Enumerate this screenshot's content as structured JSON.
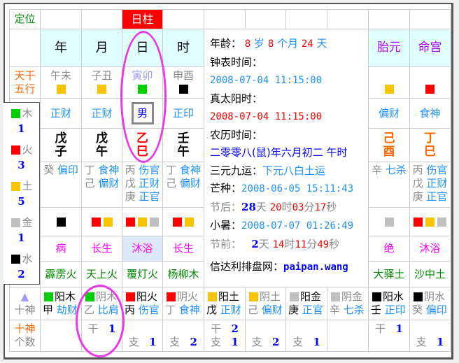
{
  "header": {
    "dingwei": "定位",
    "rizhu": "日柱",
    "pillars": [
      "年",
      "月",
      "日",
      "时"
    ],
    "taiyuan": "胎元",
    "minggong": "命宫"
  },
  "labels": {
    "tiangan_wuxing": [
      "天干",
      "五行"
    ],
    "shishen": "十神",
    "shishen_count": [
      "十神",
      "个数"
    ],
    "triangle": "▲"
  },
  "kongwang": [
    "午未",
    "子丑",
    "寅卯",
    "申酉"
  ],
  "kongwang_colors": [
    "#f8c400",
    "#f8c400",
    "#00d000",
    "#000000"
  ],
  "stem_gods": [
    "正财",
    "正财",
    "男",
    "正印"
  ],
  "pillar_chars": [
    [
      "戊",
      "子"
    ],
    [
      "戊",
      "午"
    ],
    [
      "乙",
      "巳"
    ],
    [
      "壬",
      "午"
    ]
  ],
  "hidden": [
    [
      [
        "癸",
        "偏印"
      ]
    ],
    [
      [
        "丁",
        "食神"
      ],
      [
        "己",
        "偏财"
      ]
    ],
    [
      [
        "丙",
        "伤官"
      ],
      [
        "戊",
        "正财"
      ],
      [
        "庚",
        "正官"
      ]
    ],
    [
      [
        "丁",
        "食神"
      ],
      [
        "己",
        "偏财"
      ]
    ]
  ],
  "hidden_colors": [
    [
      "#000000"
    ],
    [
      "#ff0000",
      "#f8c400"
    ],
    [
      "#ff0000",
      "#f8c400",
      "#c0c0c0"
    ],
    [
      "#ff0000",
      "#f8c400"
    ]
  ],
  "changsheng": [
    "病",
    "长生",
    "沐浴",
    "长生"
  ],
  "nayin": [
    "霹雳火",
    "天上火",
    "覆灯火",
    "杨柳木"
  ],
  "extra": {
    "colors": [
      "#f8c400",
      "#ff0000"
    ],
    "gods": [
      "偏财",
      "食神"
    ],
    "chars": [
      [
        "己",
        "酉"
      ],
      [
        "丁",
        "巳"
      ]
    ],
    "hidden": [
      [
        [
          "辛",
          "七杀"
        ]
      ],
      [
        [
          "丙",
          "伤官"
        ],
        [
          "戊",
          "正财"
        ],
        [
          "庚",
          "正官"
        ]
      ]
    ],
    "hidden_colors": [
      [
        "#c0c0c0"
      ],
      [
        "#ff0000",
        "#f8c400",
        "#c0c0c0"
      ]
    ],
    "changsheng": [
      "绝",
      "沐浴"
    ],
    "nayin": [
      "大驿土",
      "沙中土"
    ]
  },
  "info": {
    "age_label": "年龄：",
    "age_years": "8",
    "sui": "岁",
    "age_months": "8",
    "geyue": "个月",
    "age_days": "24",
    "tian": "天",
    "clock_label": "钟表时间：",
    "clock_time": "2008-07-04 11:15:00",
    "solar_label": "真太阳时：",
    "solar_time": "2008-07-04 11:15:00",
    "lunar_label": "农历时间：",
    "lunar_time": "二零零八(鼠)年六月初二 午时",
    "sanyuan_label": "三元九运：",
    "sanyuan": "下元八白土运",
    "mangzhong_label": "芒种：",
    "mangzhong": "2008-06-05 15:11:43",
    "jiehou_label": "节后：",
    "jiehou": {
      "d": "28",
      "h": "20",
      "m": "03",
      "s": "17"
    },
    "xiaoshu_label": "小暑：",
    "xiaoshu": "2008-07-07 01:26:49",
    "jieqian_label": "节前：",
    "jieqian": {
      "d": "2",
      "h": "14",
      "m": "11",
      "s": "49"
    },
    "units": {
      "d": "天",
      "h": "时",
      "m": "分",
      "s": "秒"
    },
    "site_label": "信达利排盘网：",
    "site": "paipan.wang"
  },
  "legend": [
    {
      "name": "木",
      "count": "1",
      "color": "#00d000"
    },
    {
      "name": "火",
      "count": "3",
      "color": "#ff0000"
    },
    {
      "name": "土",
      "count": "5",
      "color": "#f8c400"
    },
    {
      "name": "金",
      "count": "1",
      "color": "#c0c0c0"
    },
    {
      "name": "水",
      "count": "2",
      "color": "#000000"
    }
  ],
  "gods_table": [
    {
      "color": "#00d000",
      "el": "阳木",
      "stem": "甲",
      "god": "劫财",
      "yang": true
    },
    {
      "color": "#00d000",
      "el": "阴木",
      "stem": "乙",
      "god": "比肩",
      "yang": false
    },
    {
      "color": "#ff0000",
      "el": "阳火",
      "stem": "丙",
      "god": "伤官",
      "yang": true
    },
    {
      "color": "#ff0000",
      "el": "阴火",
      "stem": "丁",
      "god": "食神",
      "yang": false
    },
    {
      "color": "#f8c400",
      "el": "阳土",
      "stem": "戊",
      "god": "正财",
      "yang": true
    },
    {
      "color": "#f8c400",
      "el": "阴土",
      "stem": "己",
      "god": "偏财",
      "yang": false
    },
    {
      "color": "#c0c0c0",
      "el": "阳金",
      "stem": "庚",
      "god": "正官",
      "yang": true
    },
    {
      "color": "#c0c0c0",
      "el": "阴金",
      "stem": "辛",
      "god": "七杀",
      "yang": false
    },
    {
      "color": "#000000",
      "el": "阳水",
      "stem": "壬",
      "god": "正印",
      "yang": true
    },
    {
      "color": "#000000",
      "el": "阴水",
      "stem": "癸",
      "god": "偏印",
      "yang": false
    }
  ],
  "counts_labels": {
    "gan": "干",
    "zhi": "支"
  },
  "counts": [
    {
      "gan": "",
      "zhi": ""
    },
    {
      "gan": "1",
      "zhi": ""
    },
    {
      "gan": "",
      "zhi": "1"
    },
    {
      "gan": "",
      "zhi": "2"
    },
    {
      "gan": "2",
      "zhi": "1"
    },
    {
      "gan": "",
      "zhi": "2"
    },
    {
      "gan": "",
      "zhi": "1"
    },
    {
      "gan": "",
      "zhi": ""
    },
    {
      "gan": "1",
      "zhi": ""
    },
    {
      "gan": "",
      "zhi": "1"
    }
  ]
}
